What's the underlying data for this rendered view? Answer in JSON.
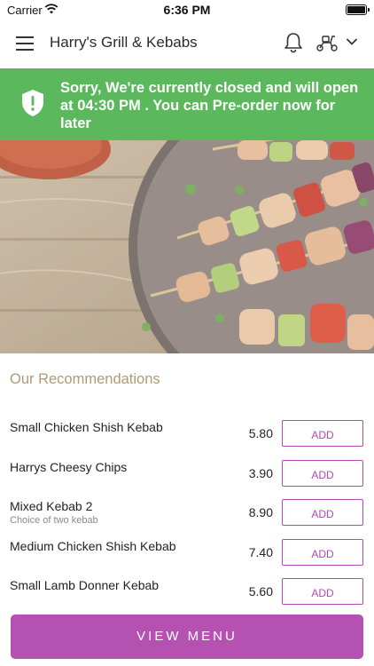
{
  "status_bar": {
    "carrier": "Carrier",
    "time": "6:36 PM"
  },
  "header": {
    "title": "Harry's Grill & Kebabs",
    "icons": [
      "menu-icon",
      "bell-icon",
      "scooter-icon",
      "chevron-down-icon"
    ]
  },
  "banner": {
    "text": "Sorry, We're currently closed and will open at 04:30 PM . You can Pre-order now for later",
    "color": "#5cb85c",
    "icon": "shield-alert-icon"
  },
  "recommendations": {
    "heading": "Our Recommendations",
    "items": [
      {
        "name": "Small Chicken Shish Kebab",
        "price": "5.80",
        "add_label": "ADD"
      },
      {
        "name": "Harrys Cheesy Chips",
        "price": "3.90",
        "add_label": "ADD"
      },
      {
        "name": "Mixed Kebab 2",
        "subtitle": "Choice of two kebab",
        "price": "8.90",
        "add_label": "ADD"
      },
      {
        "name": "Medium Chicken Shish Kebab",
        "price": "7.40",
        "add_label": "ADD"
      },
      {
        "name": "Small Lamb Donner Kebab",
        "price": "5.60",
        "add_label": "ADD"
      }
    ]
  },
  "footer": {
    "view_menu_label": "VIEW MENU",
    "accent": "#b552b1"
  }
}
